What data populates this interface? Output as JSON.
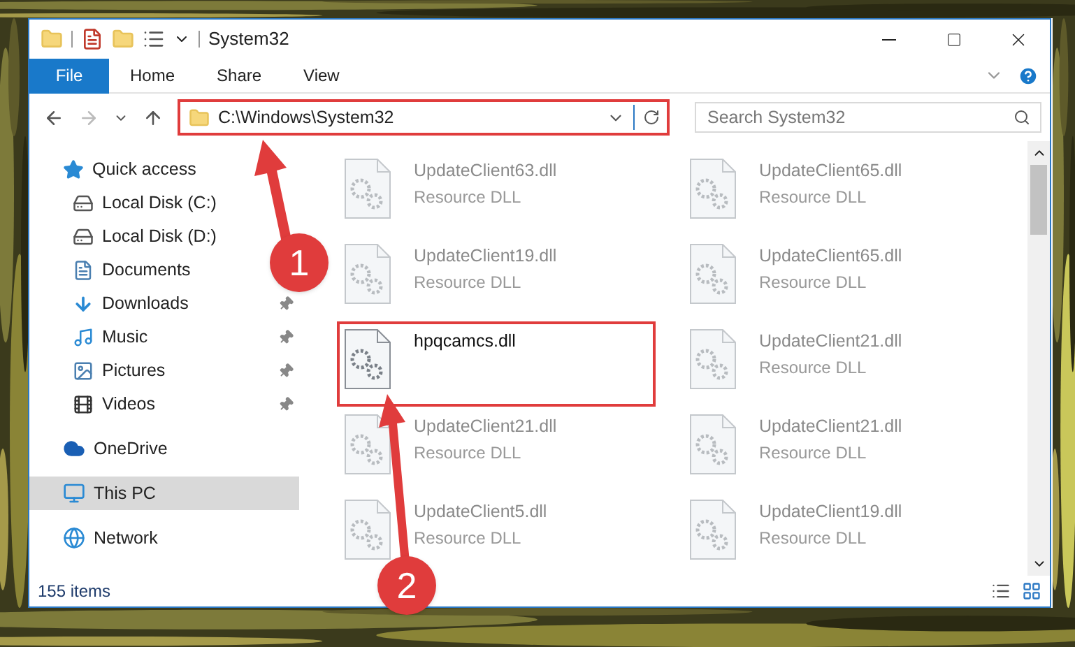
{
  "window": {
    "title": "System32"
  },
  "ribbon": {
    "tabs": [
      {
        "label": "File",
        "selected": true
      },
      {
        "label": "Home",
        "selected": false
      },
      {
        "label": "Share",
        "selected": false
      },
      {
        "label": "View",
        "selected": false
      }
    ]
  },
  "address": {
    "path": "C:\\Windows\\System32",
    "highlighted": true
  },
  "search": {
    "placeholder": "Search System32"
  },
  "nav": [
    {
      "label": "Quick access",
      "kind": "quick",
      "selected": false,
      "children": [
        {
          "label": "Local Disk (C:)",
          "kind": "disk-c",
          "pinned": false
        },
        {
          "label": "Local Disk (D:)",
          "kind": "disk",
          "pinned": false
        },
        {
          "label": "Documents",
          "kind": "documents",
          "pinned": false
        },
        {
          "label": "Downloads",
          "kind": "downloads",
          "pinned": true
        },
        {
          "label": "Music",
          "kind": "music",
          "pinned": true
        },
        {
          "label": "Pictures",
          "kind": "pictures",
          "pinned": true
        },
        {
          "label": "Videos",
          "kind": "videos",
          "pinned": true
        }
      ]
    },
    {
      "label": "OneDrive",
      "kind": "cloud",
      "selected": false
    },
    {
      "label": "This PC",
      "kind": "pc",
      "selected": true
    },
    {
      "label": "Network",
      "kind": "network",
      "selected": false
    }
  ],
  "files": [
    {
      "name": "UpdateClient63.dll",
      "type": "Resource DLL",
      "blurred": true,
      "highlighted": false
    },
    {
      "name": "UpdateClient65.dll",
      "type": "Resource DLL",
      "blurred": true,
      "highlighted": false
    },
    {
      "name": "UpdateClient19.dll",
      "type": "Resource DLL",
      "blurred": true,
      "highlighted": false
    },
    {
      "name": "UpdateClient65.dll",
      "type": "Resource DLL",
      "blurred": true,
      "highlighted": false
    },
    {
      "name": "hpqcamcs.dll",
      "blurred": false,
      "highlighted": true
    },
    {
      "name": "UpdateClient21.dll",
      "type": "Resource DLL",
      "blurred": true,
      "highlighted": false
    },
    {
      "name": "UpdateClient21.dll",
      "type": "Resource DLL",
      "blurred": true,
      "highlighted": false
    },
    {
      "name": "UpdateClient21.dll",
      "type": "Resource DLL",
      "blurred": true,
      "highlighted": false
    },
    {
      "name": "UpdateClient5.dll",
      "type": "Resource DLL",
      "blurred": true,
      "highlighted": false
    },
    {
      "name": "UpdateClient19.dll",
      "type": "Resource DLL",
      "blurred": true,
      "highlighted": false
    }
  ],
  "status_bar": {
    "count": "155 items"
  },
  "annotations": [
    {
      "number": "1"
    },
    {
      "number": "2"
    }
  ]
}
